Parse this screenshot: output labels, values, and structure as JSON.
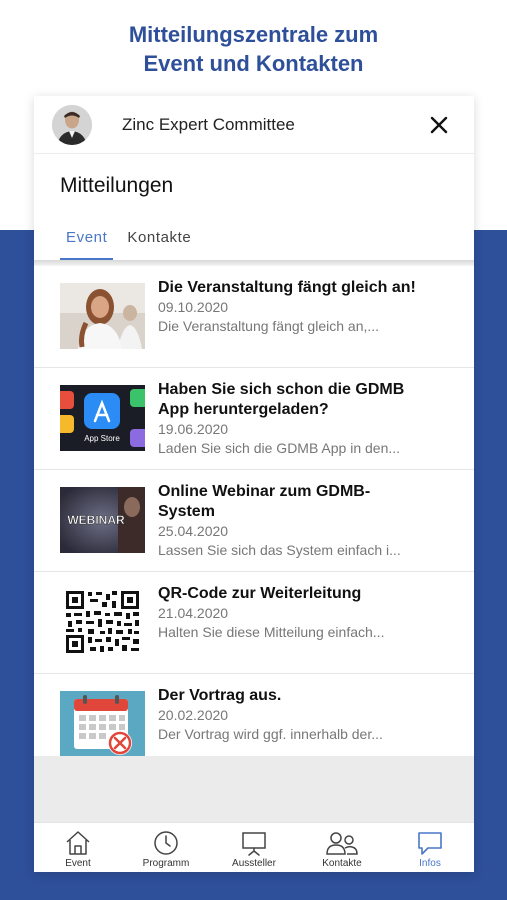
{
  "headline": {
    "line1": "Mitteilungszentrale zum",
    "line2": "Event und Kontakten"
  },
  "topbar": {
    "organization": "Zinc Expert Committee",
    "close_icon": "close-icon"
  },
  "section_title": "Mitteilungen",
  "tabs": [
    {
      "label": "Event",
      "active": true
    },
    {
      "label": "Kontakte",
      "active": false
    }
  ],
  "messages": [
    {
      "title": "Die Veranstaltung fängt gleich an!",
      "date": "09.10.2020",
      "excerpt": "Die Veranstaltung fängt gleich an,...",
      "thumb": "woman-photo"
    },
    {
      "title": "Haben Sie sich schon die GDMB App heruntergeladen?",
      "date": "19.06.2020",
      "excerpt": "Laden Sie sich die GDMB App in den...",
      "thumb": "app-store-photo",
      "thumb_caption": "App Store"
    },
    {
      "title": "Online Webinar zum GDMB-System",
      "date": "25.04.2020",
      "excerpt": "Lassen Sie sich das System einfach i...",
      "thumb": "webinar-photo",
      "thumb_caption": "WEBINAR"
    },
    {
      "title": "QR-Code zur Weiterleitung",
      "date": "21.04.2020",
      "excerpt": "Halten Sie diese Mitteilung einfach...",
      "thumb": "qr-code"
    },
    {
      "title": "Der Vortrag aus.",
      "date": "20.02.2020",
      "excerpt": "Der Vortrag wird ggf. innerhalb der...",
      "thumb": "calendar-cancel"
    }
  ],
  "bottom_nav": [
    {
      "label": "Event",
      "icon": "home-icon",
      "active": false
    },
    {
      "label": "Programm",
      "icon": "clock-icon",
      "active": false
    },
    {
      "label": "Aussteller",
      "icon": "presentation-icon",
      "active": false
    },
    {
      "label": "Kontakte",
      "icon": "people-icon",
      "active": false
    },
    {
      "label": "Infos",
      "icon": "chat-icon",
      "active": true
    }
  ],
  "colors": {
    "brand_blue": "#2e4f99",
    "accent": "#4a76c9"
  }
}
